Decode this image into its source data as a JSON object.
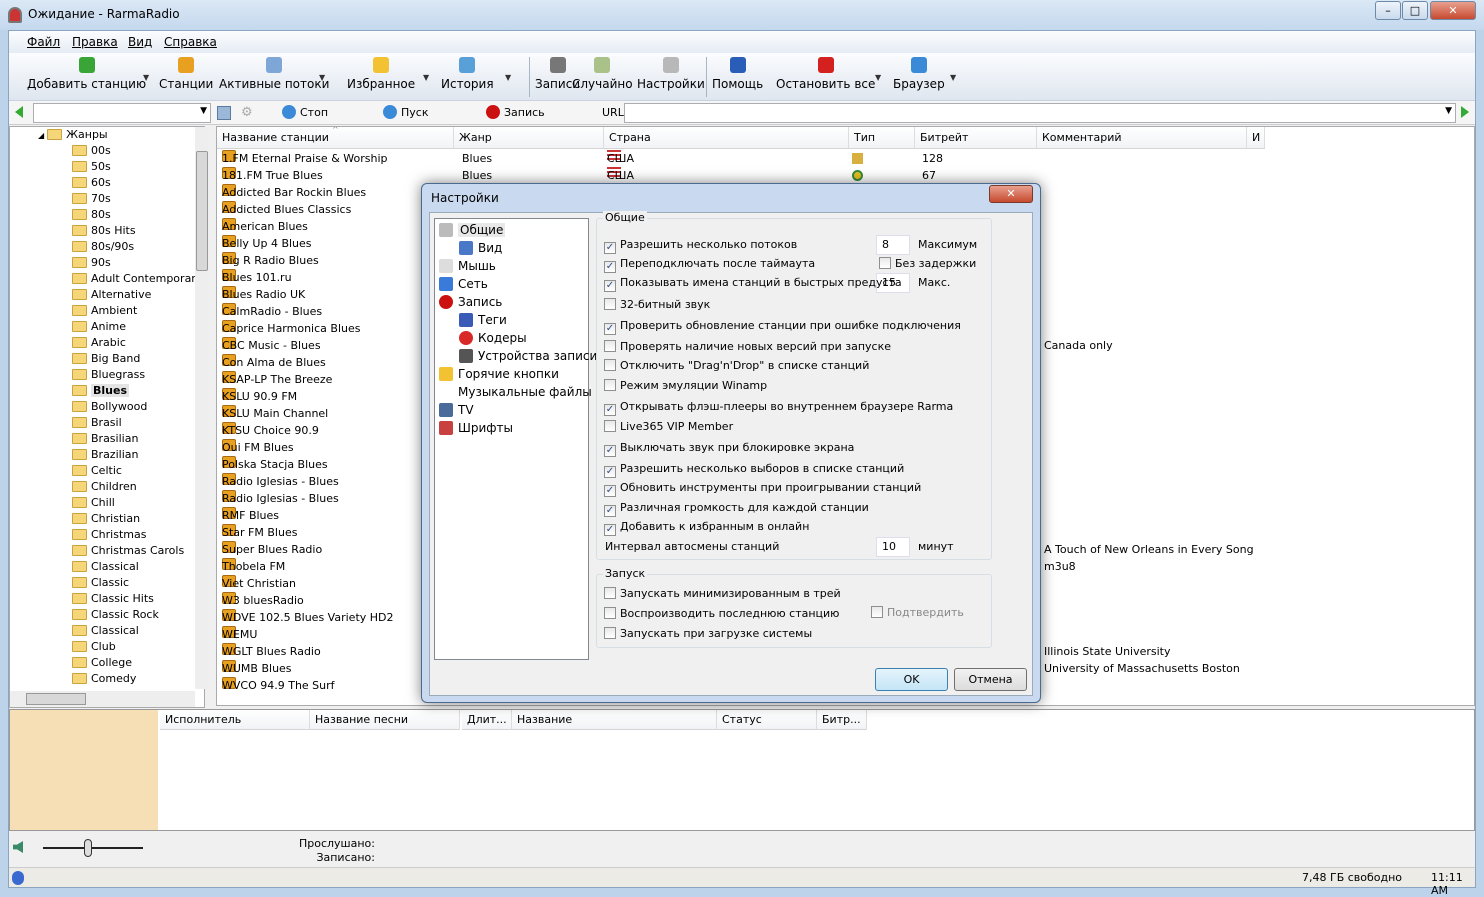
{
  "window": {
    "title": "Ожидание - RarmaRadio",
    "controls": [
      "–",
      "□",
      "✕"
    ]
  },
  "menu": [
    "Файл",
    "Правка",
    "Вид",
    "Справка"
  ],
  "toolbar": [
    {
      "label": "Добавить станцию",
      "icon": "add-icon",
      "color": "#3aa537",
      "dropdown": true
    },
    {
      "label": "Станции",
      "icon": "radio-icon",
      "color": "#e8a020",
      "dropdown": false
    },
    {
      "label": "Активные потоки",
      "icon": "list-icon",
      "color": "#7ea6d6",
      "dropdown": true
    },
    {
      "label": "Избранное",
      "icon": "star-icon",
      "color": "#f2c232",
      "dropdown": true
    },
    {
      "label": "История",
      "icon": "history-icon",
      "color": "#5aa0d8",
      "dropdown": true
    },
    {
      "label": "Записи",
      "icon": "recorder-icon",
      "color": "#777777",
      "dropdown": false
    },
    {
      "label": "Случайно",
      "icon": "random-icon",
      "color": "#aac18a",
      "dropdown": false
    },
    {
      "label": "Настройки",
      "icon": "wrench-icon",
      "color": "#b8b8b8",
      "dropdown": false
    },
    {
      "label": "Помощь",
      "icon": "help-icon",
      "color": "#2a5db8",
      "dropdown": false
    },
    {
      "label": "Остановить все",
      "icon": "stop-all-icon",
      "color": "#d52020",
      "dropdown": true
    },
    {
      "label": "Браузер",
      "icon": "browser-icon",
      "color": "#3a8ad8",
      "dropdown": true
    }
  ],
  "addressbar": {
    "stop": "Стоп",
    "play": "Пуск",
    "record": "Запись",
    "url_label": "URL",
    "url_value": "",
    "search_value": ""
  },
  "genres": {
    "root": "Жанры",
    "items": [
      "00s",
      "50s",
      "60s",
      "70s",
      "80s",
      "80s Hits",
      "80s/90s",
      "90s",
      "Adult Contemporary",
      "Alternative",
      "Ambient",
      "Anime",
      "Arabic",
      "Big Band",
      "Bluegrass",
      "Blues",
      "Bollywood",
      "Brasil",
      "Brasilian",
      "Brazilian",
      "Celtic",
      "Children",
      "Chill",
      "Christian",
      "Christmas",
      "Christmas Carols",
      "Classical",
      "Classic",
      "Classic Hits",
      "Classic Rock",
      "Classical",
      "Club",
      "College",
      "Comedy"
    ],
    "selected": "Blues"
  },
  "stations": {
    "columns": [
      "Название станции",
      "Жанр",
      "Страна",
      "Тип",
      "Битрейт",
      "Комментарий",
      "И"
    ],
    "rows": [
      {
        "name": "1.FM Eternal Praise & Worship",
        "genre": "Blues",
        "country": "США",
        "bitrate": "128",
        "comment": ""
      },
      {
        "name": "181.FM True Blues",
        "genre": "Blues",
        "country": "США",
        "bitrate": "67",
        "comment": ""
      },
      {
        "name": "Addicted Bar Rockin Blues",
        "comment": ""
      },
      {
        "name": "Addicted Blues Classics",
        "comment": ""
      },
      {
        "name": "American Blues",
        "comment": ""
      },
      {
        "name": "Belly Up 4 Blues",
        "comment": ""
      },
      {
        "name": "Big R Radio Blues",
        "comment": ""
      },
      {
        "name": "Blues 101.ru",
        "comment": ""
      },
      {
        "name": "Blues Radio UK",
        "comment": ""
      },
      {
        "name": "CalmRadio - Blues",
        "comment": ""
      },
      {
        "name": "Caprice Harmonica Blues",
        "comment": ""
      },
      {
        "name": "CBC Music - Blues",
        "comment": "Canada only"
      },
      {
        "name": "Con Alma de Blues",
        "comment": ""
      },
      {
        "name": "KSAP-LP The Breeze",
        "comment": ""
      },
      {
        "name": "KSLU 90.9 FM",
        "comment": ""
      },
      {
        "name": "KSLU Main Channel",
        "comment": ""
      },
      {
        "name": "KTSU Choice 90.9",
        "comment": ""
      },
      {
        "name": "Oui FM Blues",
        "comment": ""
      },
      {
        "name": "Polska Stacja Blues",
        "comment": ""
      },
      {
        "name": "Radio Iglesias - Blues",
        "comment": ""
      },
      {
        "name": "Radio Iglesias - Blues",
        "comment": ""
      },
      {
        "name": "RMF Blues",
        "comment": ""
      },
      {
        "name": "Star FM Blues",
        "comment": ""
      },
      {
        "name": "Super Blues Radio",
        "comment": "A Touch of New Orleans in Every Song"
      },
      {
        "name": "Thobela FM",
        "comment": "m3u8"
      },
      {
        "name": "Viet Christian",
        "comment": ""
      },
      {
        "name": "W3 bluesRadio",
        "comment": ""
      },
      {
        "name": "WDVE 102.5 Blues Variety HD2",
        "comment": ""
      },
      {
        "name": "WEMU",
        "comment": ""
      },
      {
        "name": "WGLT Blues Radio",
        "comment": "Illinois State University"
      },
      {
        "name": "WUMB Blues",
        "comment": "University of Massachusetts Boston"
      },
      {
        "name": "WVCO 94.9 The Surf",
        "comment": ""
      }
    ]
  },
  "tracks": {
    "columns": [
      "Исполнитель",
      "Название песни",
      "Длит...",
      "Название",
      "Статус",
      "Битр..."
    ]
  },
  "player": {
    "listened_label": "Прослушано:",
    "recorded_label": "Записано:",
    "volume": 0.45
  },
  "status": {
    "disk": "7,48 ГБ свободно",
    "time": "11:11 AM"
  },
  "dialog": {
    "title": "Настройки",
    "nav": [
      {
        "label": "Общие",
        "icon": "wrench-icon",
        "color": "#bbbbbb",
        "level": 0
      },
      {
        "label": "Вид",
        "icon": "window-icon",
        "color": "#4a78c8",
        "level": 1
      },
      {
        "label": "Мышь",
        "icon": "mouse-icon",
        "color": "#dddddd",
        "level": 0
      },
      {
        "label": "Сеть",
        "icon": "network-icon",
        "color": "#3a7ad8",
        "level": 0
      },
      {
        "label": "Запись",
        "icon": "record-icon",
        "color": "#cc1010",
        "level": 0
      },
      {
        "label": "Теги",
        "icon": "tag-icon",
        "color": "#3a5ab8",
        "level": 1
      },
      {
        "label": "Кодеры",
        "icon": "codec-icon",
        "color": "#d82828",
        "level": 1
      },
      {
        "label": "Устройства записи",
        "icon": "microphone-icon",
        "color": "#555555",
        "level": 1
      },
      {
        "label": "Горячие кнопки",
        "icon": "hotkey-icon",
        "color": "#f2c232",
        "level": 0
      },
      {
        "label": "Музыкальные файлы",
        "icon": "music-file-icon",
        "color": "#ffffff",
        "level": 0
      },
      {
        "label": "TV",
        "icon": "tv-icon",
        "color": "#4a6a9a",
        "level": 0
      },
      {
        "label": "Шрифты",
        "icon": "font-icon",
        "color": "#c84040",
        "level": 0
      }
    ],
    "general_group": "Общие",
    "options": [
      {
        "label": "Разрешить несколько потоков",
        "checked": true
      },
      {
        "label": "Переподключать после таймаута",
        "checked": true
      },
      {
        "label": "Показывать имена станций в быстрых предуста",
        "checked": true
      },
      {
        "label": "32-битный звук",
        "checked": false
      },
      {
        "label": "Проверить обновление станции при ошибке подключения",
        "checked": true
      },
      {
        "label": "Проверять наличие новых версий при запуске",
        "checked": false
      },
      {
        "label": "Отключить \"Drag'n'Drop\" в списке станций",
        "checked": false
      },
      {
        "label": "Режим эмуляции Winamp",
        "checked": false
      },
      {
        "label": "Открывать флэш-плееры во внутреннем браузере Rarma",
        "checked": true
      },
      {
        "label": "Live365 VIP Member",
        "checked": false
      },
      {
        "label": "Выключать звук при блокировке экрана",
        "checked": true
      },
      {
        "label": "Разрешить несколько выборов в списке станций",
        "checked": true
      },
      {
        "label": "Обновить инструменты при проигрывании станций",
        "checked": true
      },
      {
        "label": "Различная громкость для каждой станции",
        "checked": true
      },
      {
        "label": "Добавить к избранным в онлайн",
        "checked": true
      }
    ],
    "max_streams": "8",
    "max_label": "Максимум",
    "no_delay": "Без задержки",
    "max_names": "15",
    "max2_label": "Макс.",
    "interval_label": "Интервал автосмены станций",
    "interval": "10",
    "interval_unit": "минут",
    "startup_group": "Запуск",
    "startup": [
      {
        "label": "Запускать минимизированным в трей",
        "checked": false
      },
      {
        "label": "Воспроизводить последнюю станцию",
        "checked": false
      },
      {
        "label": "Запускать при загрузке системы",
        "checked": false
      }
    ],
    "confirm": "Подтвердить",
    "ok": "OK",
    "cancel": "Отмена"
  }
}
